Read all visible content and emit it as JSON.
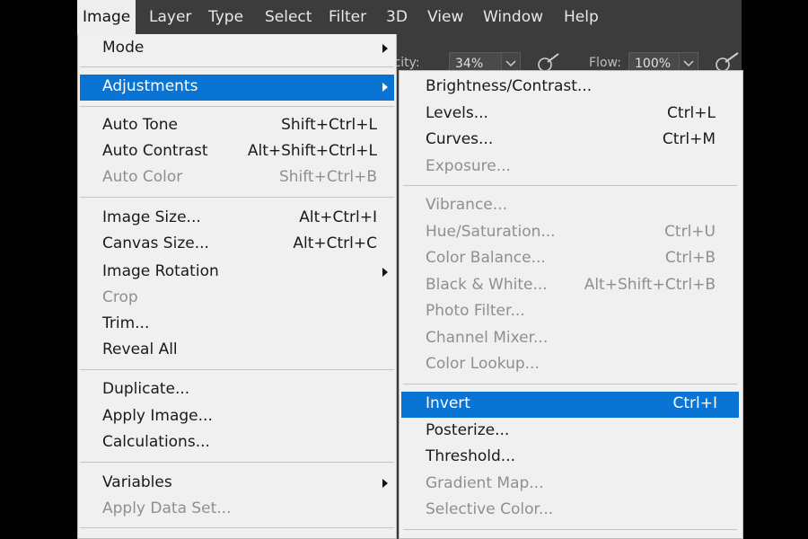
{
  "menubar": {
    "items": [
      {
        "label": "Image",
        "active": true
      },
      {
        "label": "Layer"
      },
      {
        "label": "Type"
      },
      {
        "label": "Select"
      },
      {
        "label": "Filter"
      },
      {
        "label": "3D"
      },
      {
        "label": "View"
      },
      {
        "label": "Window"
      },
      {
        "label": "Help"
      }
    ]
  },
  "options_bar": {
    "opacity_label": "acity:",
    "opacity_value": "34%",
    "flow_label": "Flow:",
    "flow_value": "100%"
  },
  "image_menu": {
    "items": [
      {
        "label": "Mode",
        "submenu": true
      },
      {
        "label": "Adjustments",
        "submenu": true,
        "highlighted": true
      },
      {
        "label": "Auto Tone",
        "shortcut": "Shift+Ctrl+L"
      },
      {
        "label": "Auto Contrast",
        "shortcut": "Alt+Shift+Ctrl+L"
      },
      {
        "label": "Auto Color",
        "shortcut": "Shift+Ctrl+B",
        "disabled": true
      },
      {
        "label": "Image Size...",
        "shortcut": "Alt+Ctrl+I"
      },
      {
        "label": "Canvas Size...",
        "shortcut": "Alt+Ctrl+C"
      },
      {
        "label": "Image Rotation",
        "submenu": true
      },
      {
        "label": "Crop",
        "disabled": true
      },
      {
        "label": "Trim..."
      },
      {
        "label": "Reveal All"
      },
      {
        "label": "Duplicate..."
      },
      {
        "label": "Apply Image..."
      },
      {
        "label": "Calculations..."
      },
      {
        "label": "Variables",
        "submenu": true
      },
      {
        "label": "Apply Data Set...",
        "disabled": true
      }
    ]
  },
  "adjustments_menu": {
    "items": [
      {
        "label": "Brightness/Contrast..."
      },
      {
        "label": "Levels...",
        "shortcut": "Ctrl+L"
      },
      {
        "label": "Curves...",
        "shortcut": "Ctrl+M"
      },
      {
        "label": "Exposure...",
        "disabled": true
      },
      {
        "label": "Vibrance...",
        "disabled": true
      },
      {
        "label": "Hue/Saturation...",
        "shortcut": "Ctrl+U",
        "disabled": true
      },
      {
        "label": "Color Balance...",
        "shortcut": "Ctrl+B",
        "disabled": true
      },
      {
        "label": "Black & White...",
        "shortcut": "Alt+Shift+Ctrl+B",
        "disabled": true
      },
      {
        "label": "Photo Filter...",
        "disabled": true
      },
      {
        "label": "Channel Mixer...",
        "disabled": true
      },
      {
        "label": "Color Lookup...",
        "disabled": true
      },
      {
        "label": "Invert",
        "shortcut": "Ctrl+I",
        "highlighted": true
      },
      {
        "label": "Posterize..."
      },
      {
        "label": "Threshold..."
      },
      {
        "label": "Gradient Map...",
        "disabled": true
      },
      {
        "label": "Selective Color...",
        "disabled": true
      }
    ]
  },
  "colors": {
    "highlight": "#0a74d4",
    "menu_bg": "#f0f0f0",
    "app_bg": "#3c3c3c",
    "disabled_text": "#8f8f8f"
  },
  "icons": [
    "chevron-down-icon",
    "airbrush-icon",
    "submenu-arrow-icon"
  ]
}
